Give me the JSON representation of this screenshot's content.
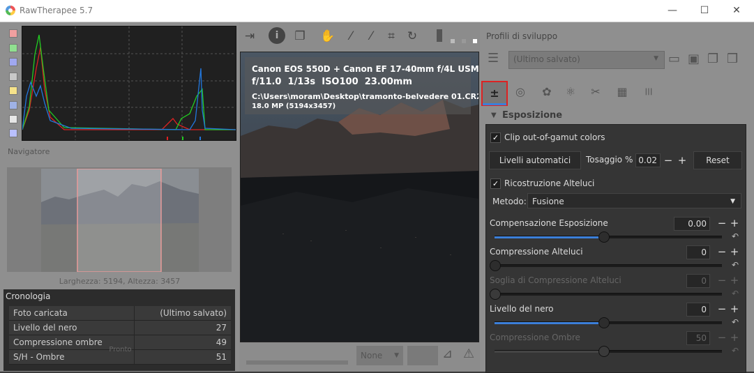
{
  "window": {
    "title": "RawTherapee 5.7",
    "minimize": "—",
    "maximize": "☐",
    "close": "✕"
  },
  "left": {
    "histogram_swatches": [
      "#f0a0a0",
      "#90e090",
      "#a0a8f0",
      "#c8c8c8",
      "#f5e28a",
      "#9fb2e6",
      "#e6e6e6",
      "#b9c0ff"
    ],
    "navigator_title": "Navigatore",
    "navigator_size": "Larghezza: 5194, Altezza: 3457",
    "history_title": "Cronologia",
    "history": [
      {
        "label": "Foto caricata",
        "value": "(Ultimo salvato)"
      },
      {
        "label": "Livello del nero",
        "value": "27"
      },
      {
        "label": "Compressione ombre",
        "value": "49"
      },
      {
        "label": "S/H - Ombre",
        "value": "51"
      }
    ]
  },
  "center": {
    "photo_info": {
      "camera": "Canon EOS 550D + Canon EF 17-40mm f/4L USM",
      "f": "f/11.0",
      "shutter": "1/13s",
      "iso": "ISO100",
      "focal": "23.00mm",
      "path": "C:\\Users\\moram\\Desktop\\tramonto-belvedere 01.CR2",
      "mp": "18.0 MP (5194x3457)"
    },
    "status": "Pronto",
    "none_select": "None"
  },
  "right": {
    "profile_title": "Profili di sviluppo",
    "profile_value": "(Ultimo salvato)",
    "exposure_title": "Esposizione",
    "clip_label": "Clip out-of-gamut colors",
    "auto_levels": "Livelli automatici",
    "clip_pct_label": "Tosaggio %",
    "clip_pct_value": "0.02",
    "reset": "Reset",
    "highlight_recon": "Ricostruzione Alteluci",
    "method_label": "Metodo:",
    "method_value": "Fusione",
    "sliders": [
      {
        "label": "Compensazione Esposizione",
        "value": "0.00",
        "level": 0.48,
        "dim": false
      },
      {
        "label": "Compressione Alteluci",
        "value": "0",
        "level": 0.0,
        "dim": false
      },
      {
        "label": "Soglia di Compressione Alteluci",
        "value": "0",
        "level": 0.0,
        "dim": true
      },
      {
        "label": "Livello del nero",
        "value": "0",
        "level": 0.48,
        "dim": false
      },
      {
        "label": "Compressione Ombre",
        "value": "50",
        "level": 0.48,
        "dim": true
      }
    ]
  }
}
